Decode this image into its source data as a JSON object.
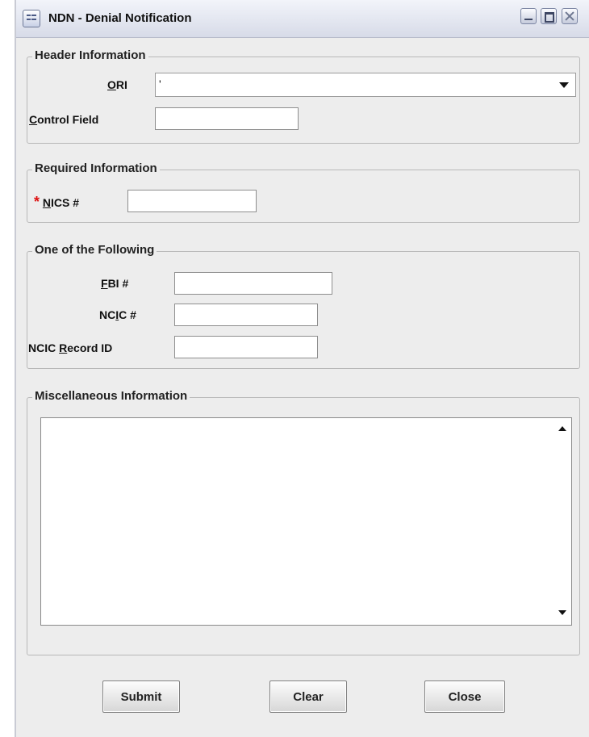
{
  "window": {
    "title": "NDN - Denial Notification"
  },
  "header_information": {
    "legend": "Header Information",
    "ori_label_prefix": "",
    "ori_label_ul": "O",
    "ori_label_rest": "RI",
    "ori_value": "'",
    "control_label_ul": "C",
    "control_label_rest": "ontrol Field",
    "control_value": ""
  },
  "required_information": {
    "legend": "Required Information",
    "required_marker": "*",
    "nics_label_ul": "N",
    "nics_label_rest": "ICS #",
    "nics_value": ""
  },
  "one_of_following": {
    "legend": "One of the Following",
    "fbi_label_ul": "F",
    "fbi_label_rest": "BI #",
    "fbi_value": "",
    "ncic_label_pre": "NC",
    "ncic_label_ul": "I",
    "ncic_label_rest": "C #",
    "ncic_value": "",
    "record_label_pre": "NCIC ",
    "record_label_ul": "R",
    "record_label_rest": "ecord ID",
    "record_value": ""
  },
  "miscellaneous": {
    "legend": "Miscellaneous Information",
    "text": ""
  },
  "buttons": {
    "submit": "Submit",
    "clear": "Clear",
    "close": "Close"
  }
}
